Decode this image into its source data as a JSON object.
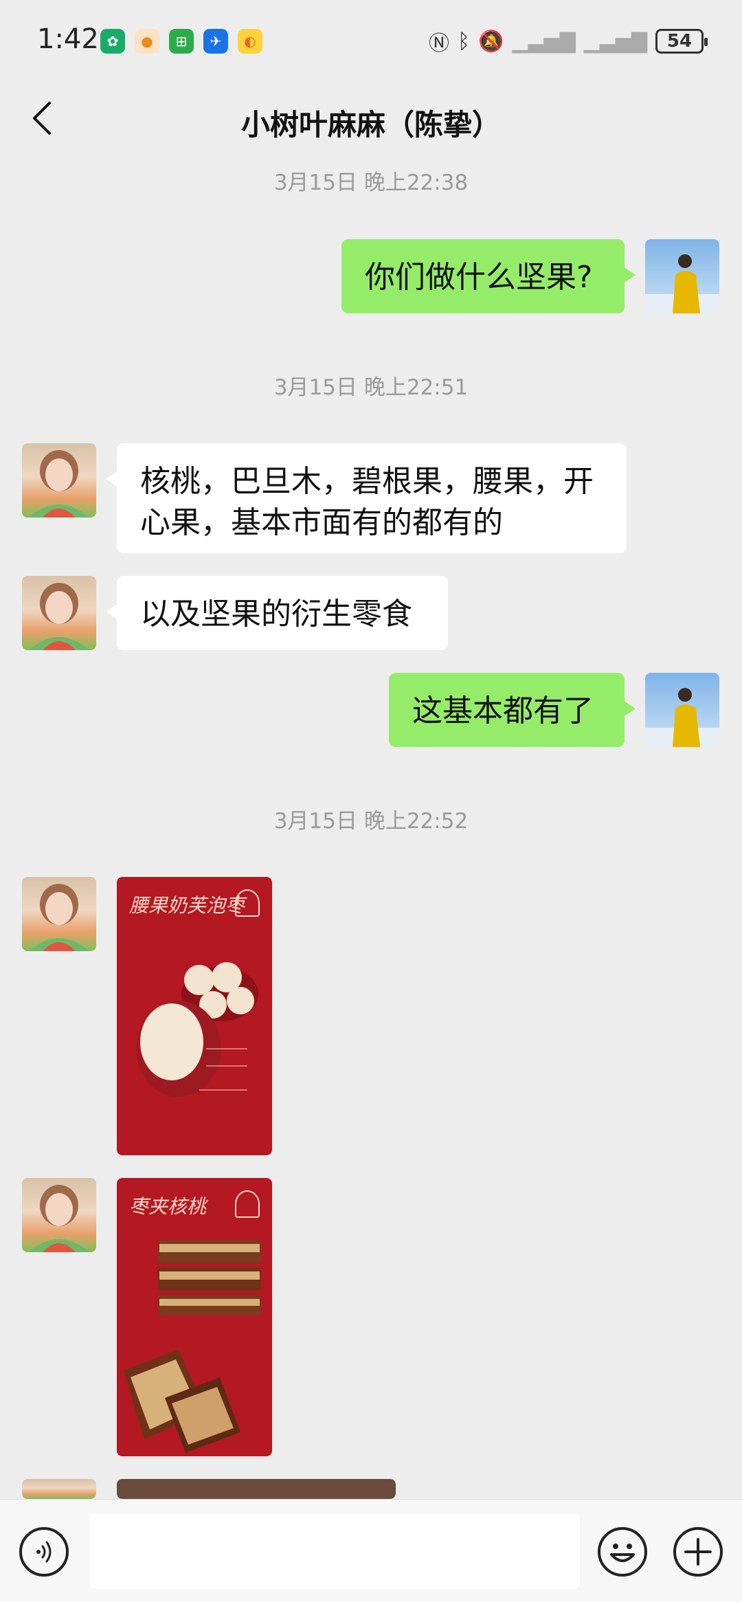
{
  "status_bar": {
    "time": "1:42",
    "battery": "54",
    "app_icons": [
      "tree-app-icon",
      "food-app-icon",
      "green-app-icon",
      "flight-app-icon",
      "duck-app-icon"
    ],
    "system_icons": [
      "nfc-icon",
      "bluetooth-icon",
      "mute-icon",
      "signal-icon",
      "signal-icon"
    ]
  },
  "header": {
    "title": "小树叶麻麻（陈挚）"
  },
  "messages": {
    "ts1": "3月15日 晚上22:38",
    "m1": "你们做什么坚果?",
    "ts2": "3月15日 晚上22:51",
    "m2_line1": "核桃，巴旦木，碧根果，腰果，开",
    "m2_line2": "心果，基本市面有的都有的",
    "m3": "以及坚果的衍生零食",
    "m4": "这基本都有了",
    "ts3": "3月15日 晚上22:52",
    "img1_title": "腰果奶芙泡枣",
    "img2_title": "枣夹核桃"
  },
  "colors": {
    "my_bubble": "#95ec69",
    "their_bubble": "#ffffff",
    "background": "#ededed",
    "product_red": "#b41822"
  },
  "bottom_bar": {
    "icons": [
      "voice-icon",
      "emoji-icon",
      "plus-icon"
    ]
  }
}
